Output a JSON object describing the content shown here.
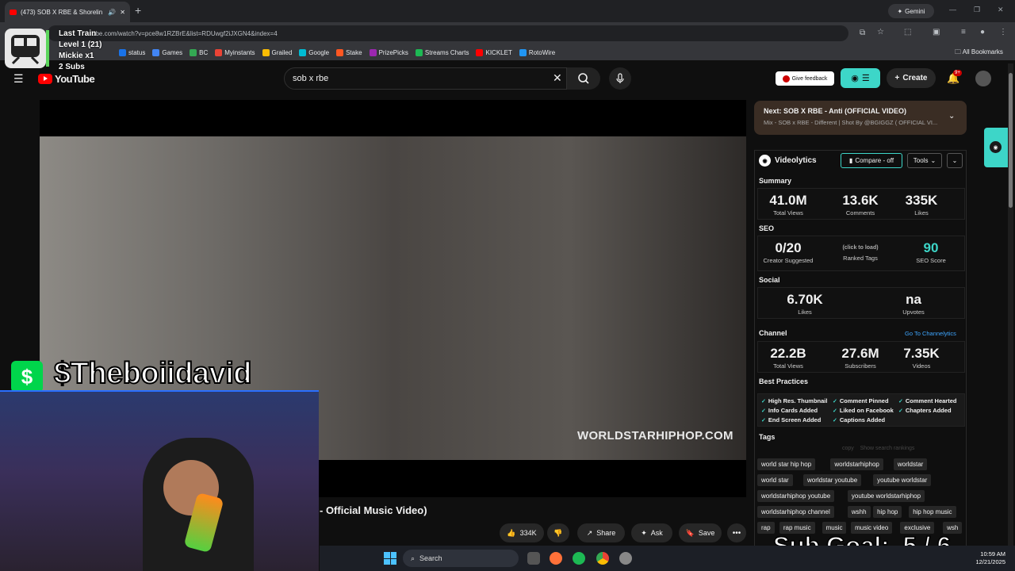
{
  "browser": {
    "tab_title": "(473) SOB X RBE & Shorelin",
    "new_tab": "+",
    "gemini": "Gemini",
    "url": "ube.com/watch?v=pce8w1RZBrE&list=RDUwgf2iJXGN4&index=4",
    "bookmarks": [
      "status",
      "Games",
      "BC",
      "Myinstants",
      "Grailed",
      "Google",
      "Stake",
      "PrizePicks",
      "Streams Charts",
      "KICKLET",
      "RotoWire"
    ],
    "all_bookmarks": "All Bookmarks",
    "bookmark_colors": [
      "#1a73e8",
      "#4285f4",
      "#34a853",
      "#ea4335",
      "#fbbc04",
      "#00bcd4",
      "#ff5722",
      "#9c27b0",
      "#1db954",
      "#ff0000",
      "#2196f3",
      "#f44336",
      "#795548"
    ]
  },
  "youtube": {
    "logo": "YouTube",
    "search_value": "sob x rbe",
    "feedback": "Give feedback",
    "create": "Create",
    "notif_count": "9+",
    "video_title": "- Official Music Video)",
    "watermark": "WORLDSTARHIPHOP.COM",
    "likes": "334K",
    "share": "Share",
    "ask": "Ask",
    "save": "Save",
    "next_label": "Next: SOB X RBE - Anti (OFFICIAL VIDEO)",
    "next_sub": "Mix - SOB x RBE - Different | Shot By @BGIGGZ ( OFFICIAL VI..."
  },
  "overlay": {
    "train_title": "Last Train",
    "train_level": "Level 1  (21)",
    "train_user": "Mickie x1",
    "train_subs": "2 Subs",
    "cash_symbol": "$",
    "cashtag": "$Theboiidavid",
    "sub_goal": "Sub Goal:  5 / 6"
  },
  "videolytics": {
    "title": "Videolytics",
    "compare": "Compare - off",
    "tools": "Tools",
    "summary_label": "Summary",
    "summary": [
      {
        "v": "41.0M",
        "l": "Total Views"
      },
      {
        "v": "13.6K",
        "l": "Comments"
      },
      {
        "v": "335K",
        "l": "Likes"
      }
    ],
    "seo_label": "SEO",
    "seo": [
      {
        "v": "0/20",
        "l": "Creator Suggested"
      },
      {
        "v": "(click to load)",
        "l": "Ranked Tags"
      },
      {
        "v": "90",
        "l": "SEO Score"
      }
    ],
    "social_label": "Social",
    "social": [
      {
        "v": "6.70K",
        "l": "Likes"
      },
      {
        "v": "na",
        "l": "Upvotes"
      }
    ],
    "channel_label": "Channel",
    "go_channel": "Go To Channelytics",
    "channel": [
      {
        "v": "22.2B",
        "l": "Total Views"
      },
      {
        "v": "27.6M",
        "l": "Subscribers"
      },
      {
        "v": "7.35K",
        "l": "Videos"
      }
    ],
    "bp_label": "Best Practices",
    "best_practices": [
      "High Res. Thumbnail",
      "Comment Pinned",
      "Comment Hearted",
      "Info Cards Added",
      "Liked on Facebook",
      "Chapters Added",
      "End Screen Added",
      "Captions Added"
    ],
    "tags_label": "Tags",
    "tags_actions": "copy    Show search rankings",
    "tags": [
      "world star hip hop",
      "worldstarhiphop",
      "worldstar",
      "world star",
      "worldstar youtube",
      "youtube worldstar",
      "worldstarhiphop youtube",
      "youtube worldstarhiphop",
      "worldstarhiphop channel",
      "wshh",
      "hip hop",
      "hip hop music",
      "rap",
      "rap music",
      "music",
      "music video",
      "exclusive",
      "wsh"
    ],
    "accent": "#3dd6c8"
  },
  "taskbar": {
    "search": "Search",
    "time": "10:59 AM",
    "date": "12/21/2025"
  }
}
